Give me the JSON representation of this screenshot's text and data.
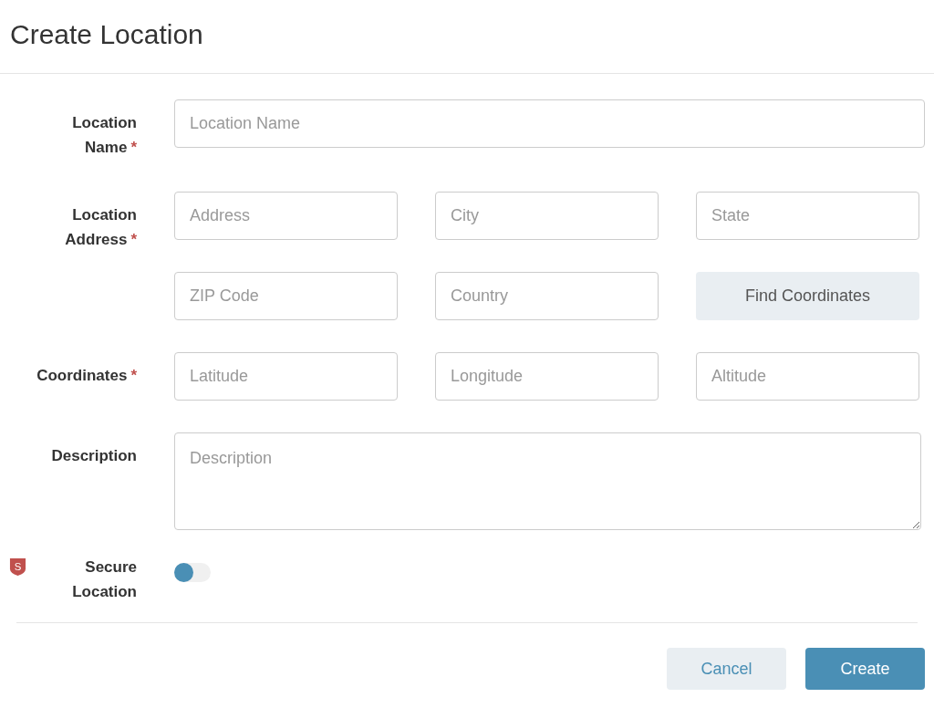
{
  "title": "Create Location",
  "rows": [
    {
      "kind": "single",
      "label": "Location Name",
      "required_mark": "*",
      "items": [
        {
          "kind": "input",
          "placeholder": "Location Name"
        }
      ]
    },
    {
      "kind": "grid",
      "label": "Location Address",
      "required_mark": "*",
      "items": [
        {
          "kind": "input",
          "placeholder": "Address"
        },
        {
          "kind": "input",
          "placeholder": "City"
        },
        {
          "kind": "input",
          "placeholder": "State"
        },
        {
          "kind": "input",
          "placeholder": "ZIP Code"
        },
        {
          "kind": "input",
          "placeholder": "Country"
        },
        {
          "kind": "button",
          "label": "Find Coordinates"
        }
      ]
    },
    {
      "kind": "grid",
      "label": "Coordinates",
      "required_mark": "*",
      "items": [
        {
          "kind": "input",
          "placeholder": "Latitude"
        },
        {
          "kind": "input",
          "placeholder": "Longitude"
        },
        {
          "kind": "input",
          "placeholder": "Altitude"
        }
      ]
    },
    {
      "kind": "textarea",
      "label": "Description",
      "items": [
        {
          "kind": "textarea",
          "placeholder": "Description"
        }
      ]
    },
    {
      "kind": "toggle",
      "label": "Secure Location",
      "icon_letter": "S",
      "on": false
    }
  ],
  "buttons": [
    {
      "label": "Cancel",
      "kind": "secondary"
    },
    {
      "label": "Create",
      "kind": "primary"
    }
  ]
}
